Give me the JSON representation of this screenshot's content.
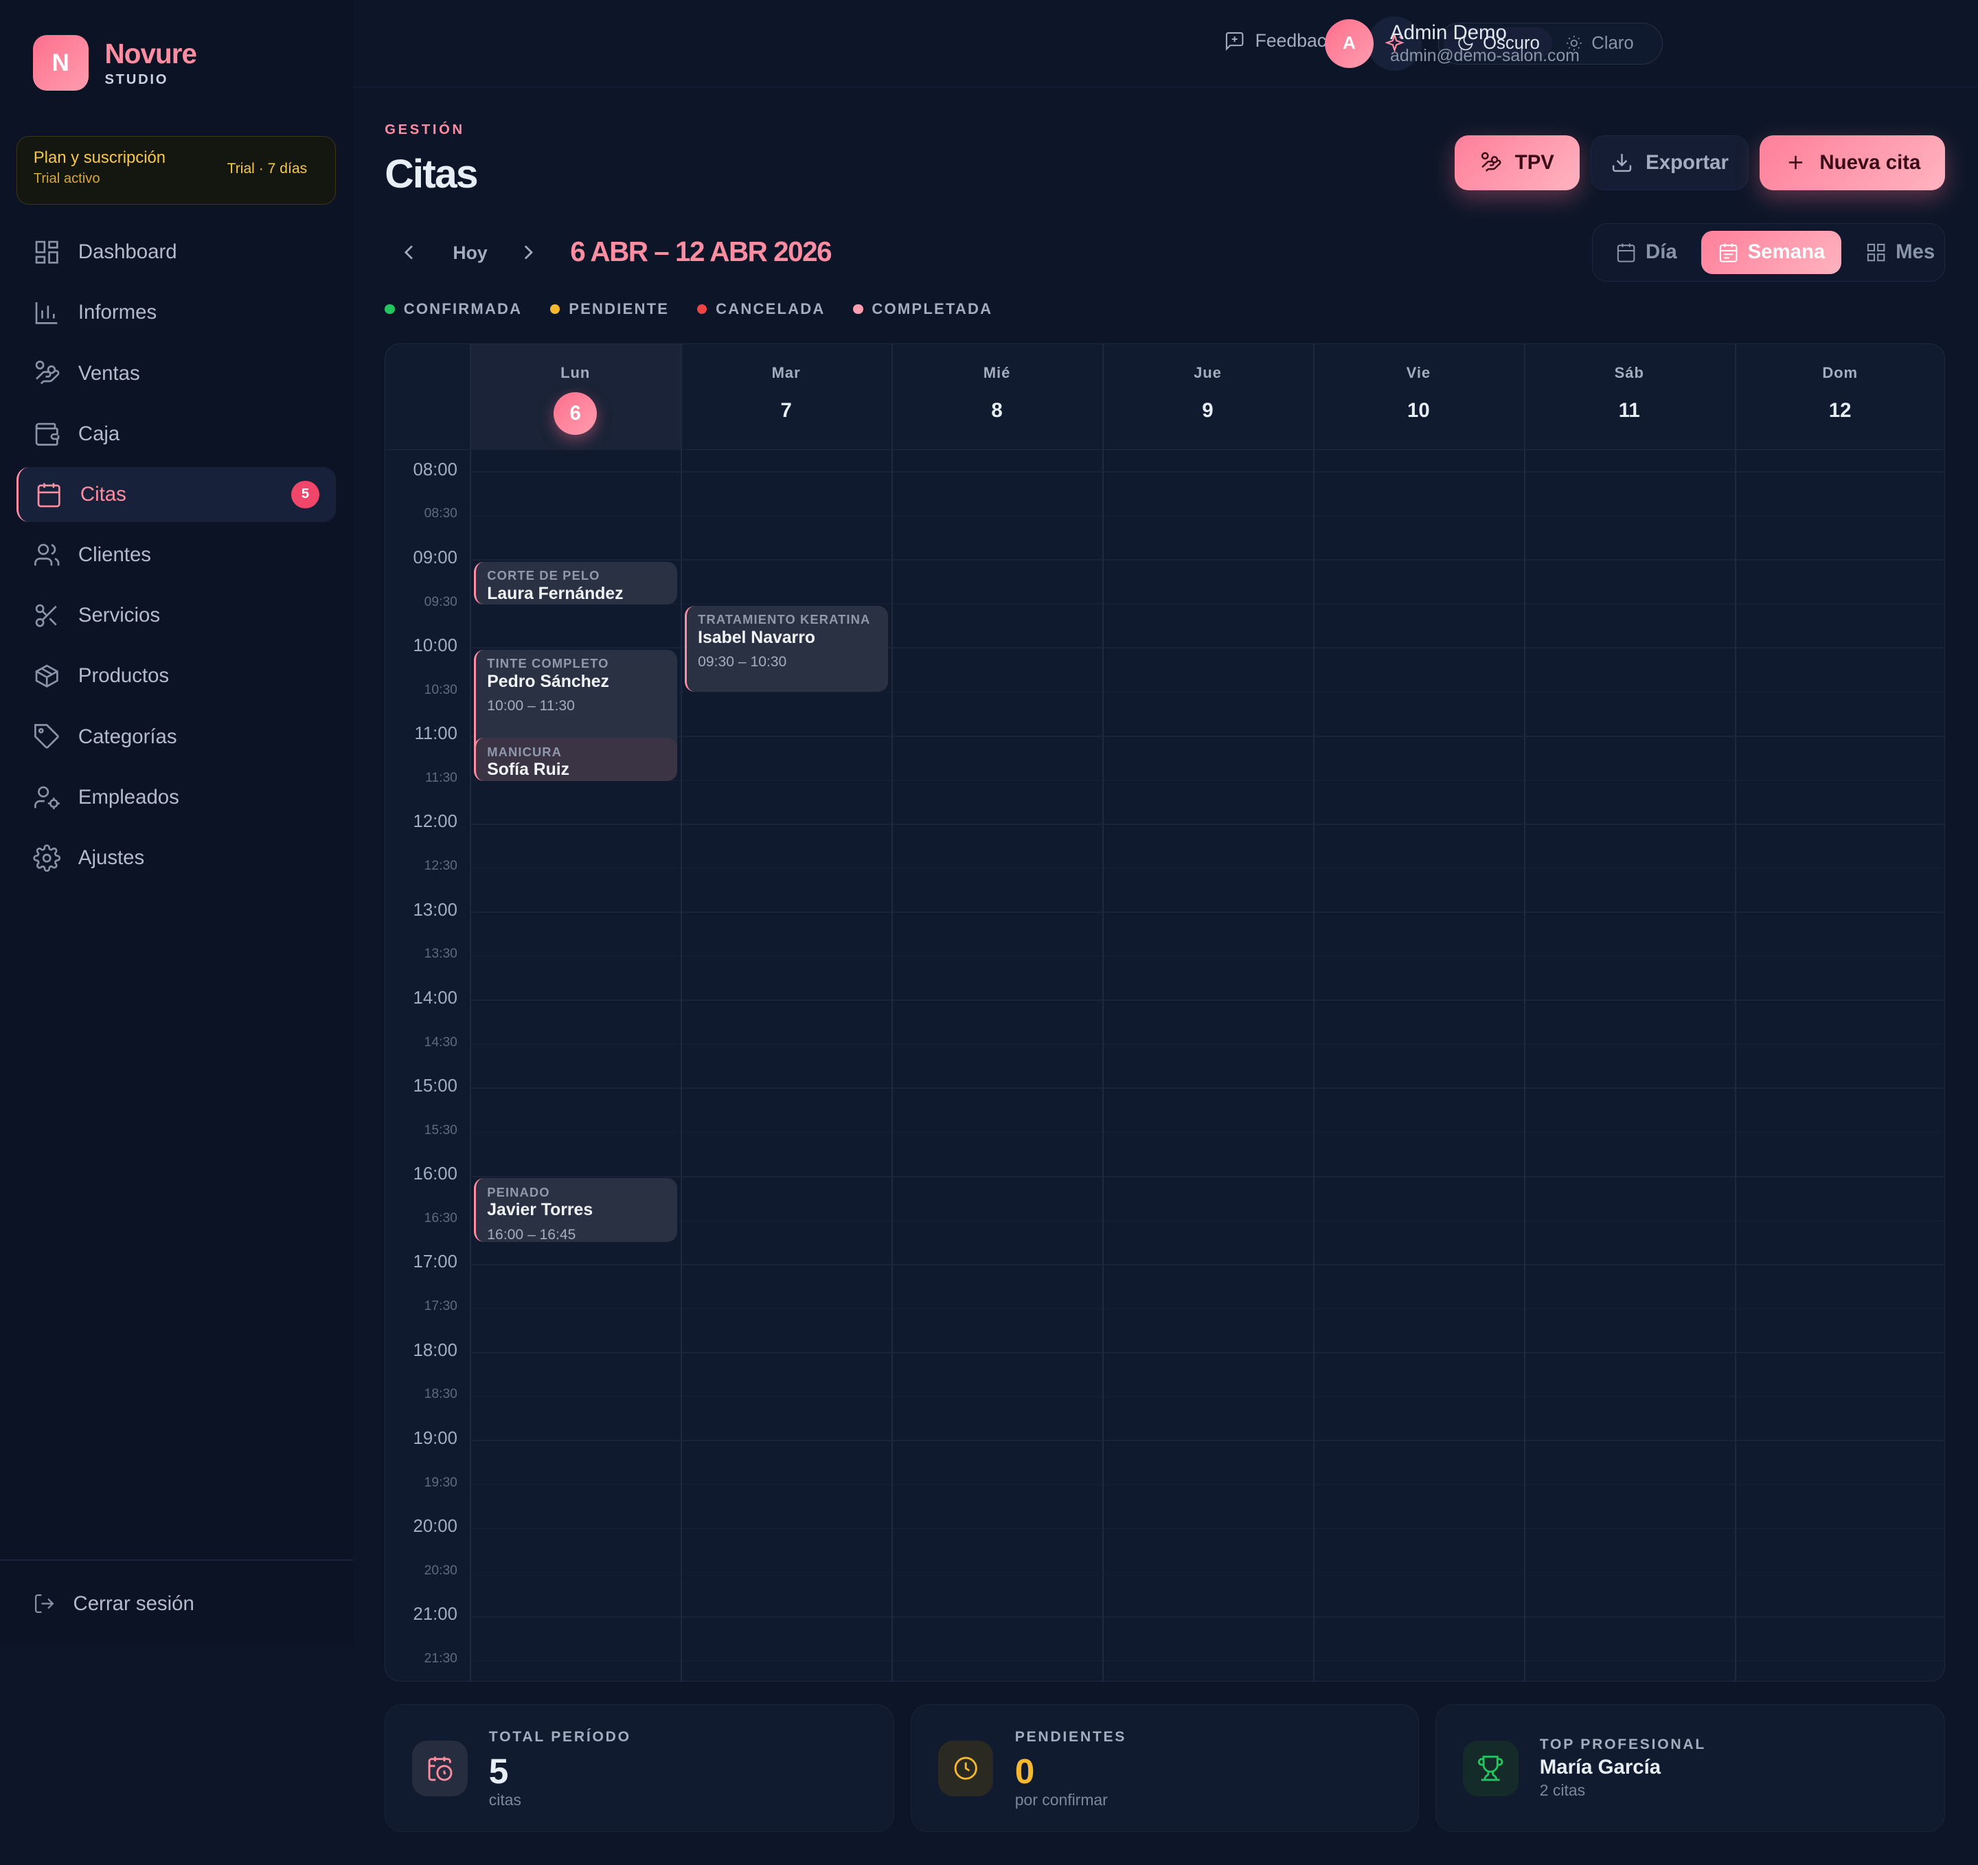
{
  "brand": {
    "name": "Novure",
    "sub": "STUDIO",
    "mark": "N"
  },
  "plan": {
    "title": "Plan y suscripción",
    "sub": "Trial activo",
    "trial": "Trial · 7 días"
  },
  "sidebar": {
    "items": [
      {
        "label": "Dashboard",
        "icon": "dashboard-icon"
      },
      {
        "label": "Informes",
        "icon": "bar-chart-icon"
      },
      {
        "label": "Ventas",
        "icon": "hand-coins-icon"
      },
      {
        "label": "Caja",
        "icon": "wallet-icon"
      },
      {
        "label": "Citas",
        "icon": "calendar-icon",
        "badge": "5",
        "active": true
      },
      {
        "label": "Clientes",
        "icon": "users-icon"
      },
      {
        "label": "Servicios",
        "icon": "scissors-icon"
      },
      {
        "label": "Productos",
        "icon": "package-icon"
      },
      {
        "label": "Categorías",
        "icon": "tag-icon"
      },
      {
        "label": "Empleados",
        "icon": "user-cog-icon"
      },
      {
        "label": "Ajustes",
        "icon": "settings-icon"
      }
    ],
    "logout": "Cerrar sesión"
  },
  "topbar": {
    "feedback": "Feedback",
    "theme_dark": "Oscuro",
    "theme_light": "Claro",
    "user_initial": "A",
    "user_name": "Admin Demo",
    "user_email": "admin@demo-salon.com"
  },
  "header": {
    "section": "GESTIÓN",
    "title": "Citas",
    "tpv": "TPV",
    "export": "Exportar",
    "new": "Nueva cita"
  },
  "toolbar": {
    "today": "Hoy",
    "range": "6 ABR – 12 ABR 2026",
    "views": [
      "Día",
      "Semana",
      "Mes"
    ],
    "active_view": "Semana"
  },
  "legend": [
    {
      "label": "CONFIRMADA",
      "color": "#22c55e"
    },
    {
      "label": "PENDIENTE",
      "color": "#f5b82e"
    },
    {
      "label": "CANCELADA",
      "color": "#ef4444"
    },
    {
      "label": "COMPLETADA",
      "color": "#ff9db0"
    }
  ],
  "calendar": {
    "days": [
      {
        "name": "Lun",
        "num": "6",
        "today": true
      },
      {
        "name": "Mar",
        "num": "7"
      },
      {
        "name": "Mié",
        "num": "8"
      },
      {
        "name": "Jue",
        "num": "9"
      },
      {
        "name": "Vie",
        "num": "10"
      },
      {
        "name": "Sáb",
        "num": "11"
      },
      {
        "name": "Dom",
        "num": "12"
      }
    ],
    "hours": [
      "08:00",
      "09:00",
      "10:00",
      "11:00",
      "12:00",
      "13:00",
      "14:00",
      "15:00",
      "16:00",
      "17:00",
      "18:00",
      "19:00",
      "20:00",
      "21:00"
    ],
    "halves": [
      "08:30",
      "09:30",
      "10:30",
      "11:30",
      "12:30",
      "13:30",
      "14:30",
      "15:30",
      "16:30",
      "17:30",
      "18:30",
      "19:30",
      "20:30",
      "21:30"
    ],
    "appointments": [
      {
        "day": 0,
        "service": "CORTE DE PELO",
        "client": "Laura Fernández",
        "time": "",
        "start": "09:00",
        "end": "09:30"
      },
      {
        "day": 0,
        "service": "TINTE COMPLETO",
        "client": "Pedro Sánchez",
        "time": "10:00 – 11:30",
        "start": "10:00",
        "end": "11:30"
      },
      {
        "day": 0,
        "service": "MANICURA",
        "client": "Sofía Ruiz",
        "time": "",
        "start": "11:00",
        "end": "11:30",
        "alt": true
      },
      {
        "day": 0,
        "service": "PEINADO",
        "client": "Javier Torres",
        "time": "16:00 – 16:45",
        "start": "16:00",
        "end": "16:45"
      },
      {
        "day": 1,
        "service": "TRATAMIENTO KERATINA",
        "client": "Isabel Navarro",
        "time": "09:30 – 10:30",
        "start": "09:30",
        "end": "10:30"
      }
    ]
  },
  "stats": [
    {
      "label": "TOTAL PERÍODO",
      "value": "5",
      "sub": "citas",
      "icon": "calendar-clock-icon",
      "color": "#e8eef6"
    },
    {
      "label": "PENDIENTES",
      "value": "0",
      "sub": "por confirmar",
      "icon": "clock-icon",
      "color": "#f5b82e"
    },
    {
      "label": "TOP PROFESIONAL",
      "value": "María García",
      "sub": "2 citas",
      "icon": "trophy-icon",
      "color": "#e8eef6"
    }
  ]
}
